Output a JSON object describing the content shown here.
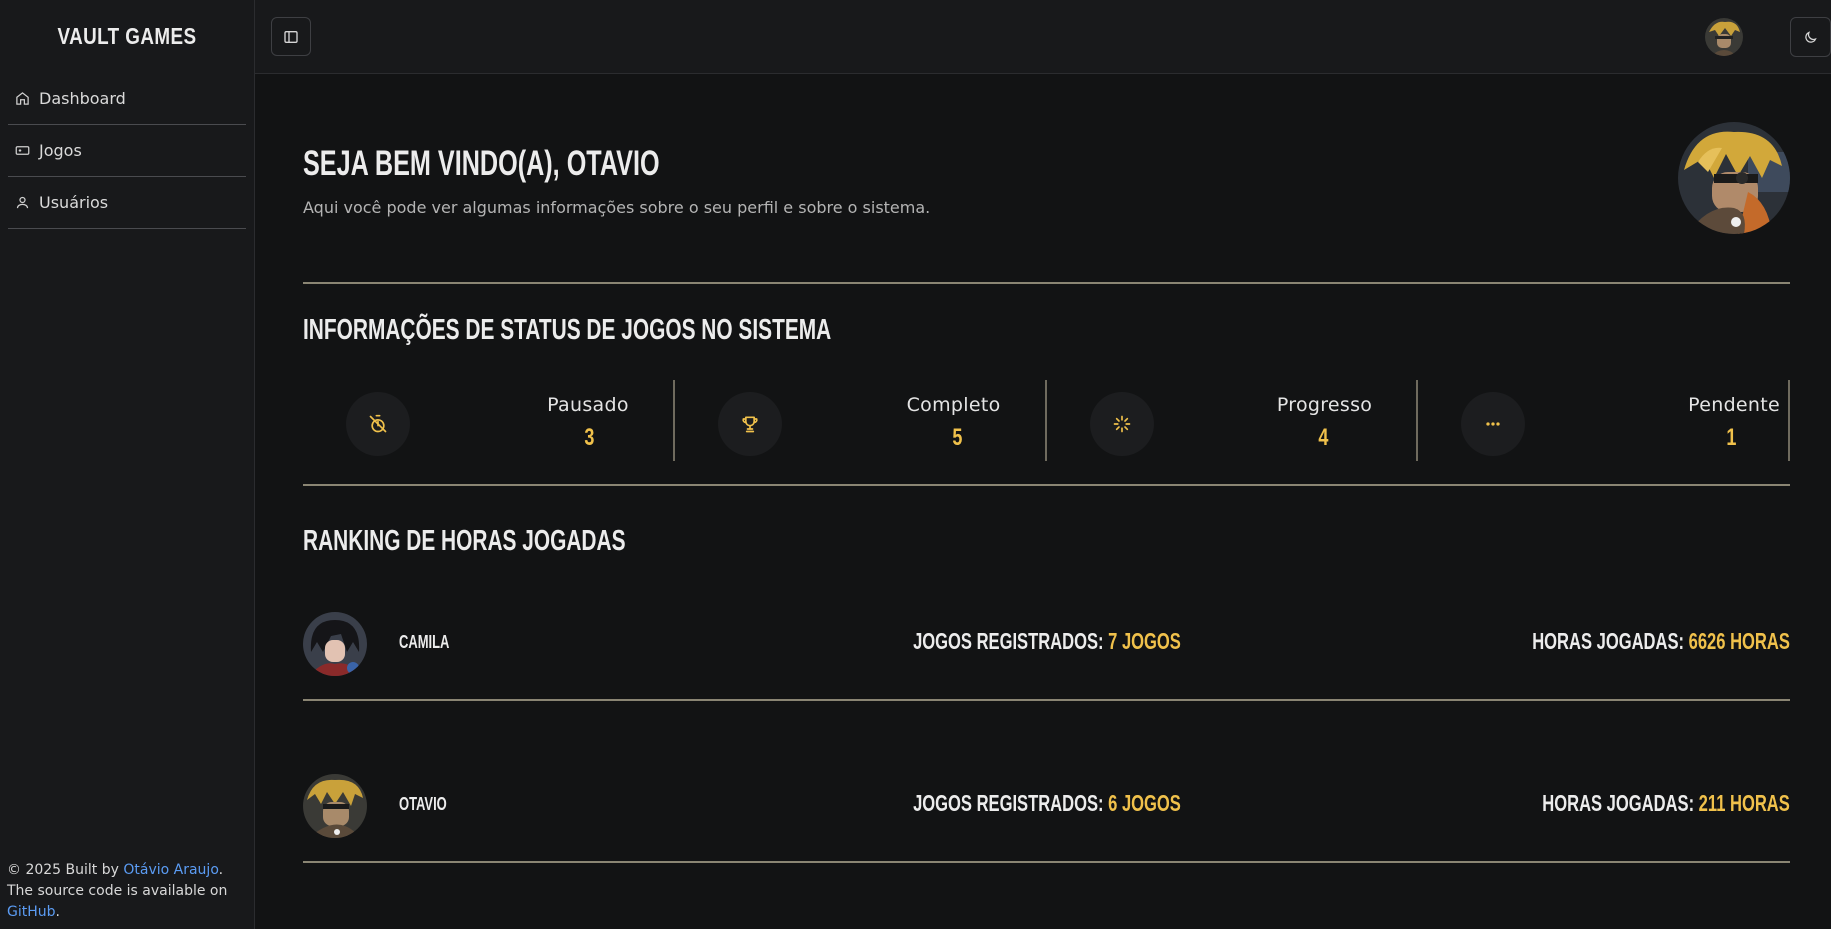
{
  "app": {
    "brand": "VAULT GAMES"
  },
  "sidebar": {
    "items": [
      {
        "label": "Dashboard",
        "icon": "home-icon"
      },
      {
        "label": "Jogos",
        "icon": "gamepad-icon"
      },
      {
        "label": "Usuários",
        "icon": "user-icon"
      }
    ],
    "footer": {
      "prefix": "© 2025 Built by ",
      "author": "Otávio Araujo",
      "middle": ". The source code is available on ",
      "repo": "GitHub",
      "suffix": "."
    }
  },
  "topbar": {
    "toggle_icon": "sidebar-toggle-icon",
    "theme_icon": "moon-icon"
  },
  "welcome": {
    "title": "SEJA BEM VINDO(A), OTAVIO",
    "subtitle": "Aqui você pode ver algumas informações sobre o seu perfil e sobre o sistema."
  },
  "status": {
    "title": "INFORMAÇÕES DE STATUS DE JOGOS NO SISTEMA",
    "items": [
      {
        "label": "Pausado",
        "value": "3",
        "icon": "timer-off-icon"
      },
      {
        "label": "Completo",
        "value": "5",
        "icon": "trophy-icon"
      },
      {
        "label": "Progresso",
        "value": "4",
        "icon": "loader-icon"
      },
      {
        "label": "Pendente",
        "value": "1",
        "icon": "ellipsis-icon"
      }
    ]
  },
  "ranking": {
    "title": "RANKING DE HORAS JOGADAS",
    "games_label": "JOGOS REGISTRADOS:",
    "hours_label": "HORAS JOGADAS:",
    "rows": [
      {
        "name": "CAMILA",
        "games": "7 JOGOS",
        "hours": "6626 HORAS"
      },
      {
        "name": "OTAVIO",
        "games": "6 JOGOS",
        "hours": "211 HORAS"
      }
    ]
  },
  "colors": {
    "accent": "#f0c14b",
    "link": "#5b9cf4",
    "background": "#121314",
    "divider": "#8a8573"
  }
}
